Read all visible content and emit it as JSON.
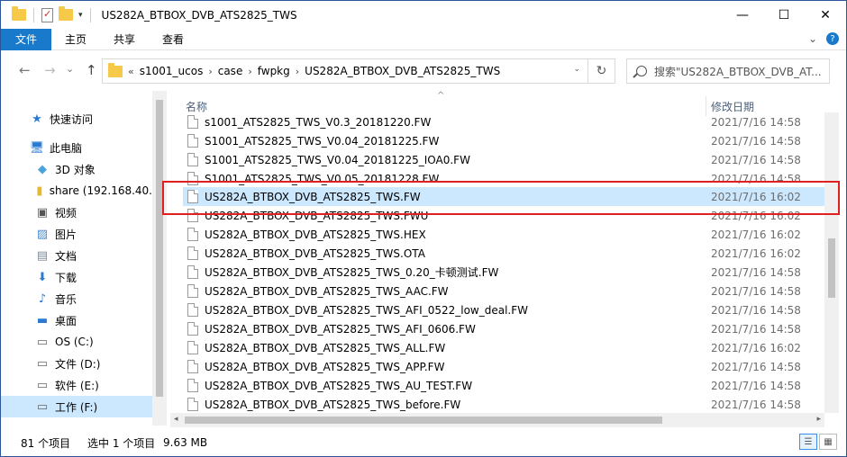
{
  "window": {
    "title": "US282A_BTBOX_DVB_ATS2825_TWS",
    "controls": {
      "minimize": "—",
      "maximize": "☐",
      "close": "✕"
    }
  },
  "ribbon": {
    "tabs": [
      "文件",
      "主页",
      "共享",
      "查看"
    ]
  },
  "nav": {
    "back": "←",
    "forward": "→",
    "recent": "⌄",
    "up": "↑",
    "overflow": "«",
    "breadcrumb": [
      "s1001_ucos",
      "case",
      "fwpkg",
      "US282A_BTBOX_DVB_ATS2825_TWS"
    ],
    "refresh": "↻",
    "search_placeholder": "搜索\"US282A_BTBOX_DVB_AT..."
  },
  "sidebar": {
    "items": [
      {
        "label": "快速访问",
        "icon": "star-icon"
      },
      {
        "label": "此电脑",
        "icon": "computer-icon"
      },
      {
        "label": "3D 对象",
        "icon": "cube-icon"
      },
      {
        "label": "share (192.168.40.",
        "icon": "network-drive-icon"
      },
      {
        "label": "视频",
        "icon": "video-icon"
      },
      {
        "label": "图片",
        "icon": "picture-icon"
      },
      {
        "label": "文档",
        "icon": "document-icon"
      },
      {
        "label": "下载",
        "icon": "download-icon"
      },
      {
        "label": "音乐",
        "icon": "music-icon"
      },
      {
        "label": "桌面",
        "icon": "desktop-icon"
      },
      {
        "label": "OS (C:)",
        "icon": "drive-icon"
      },
      {
        "label": "文件 (D:)",
        "icon": "drive-icon"
      },
      {
        "label": "软件 (E:)",
        "icon": "drive-icon"
      },
      {
        "label": "工作 (F:)",
        "icon": "drive-icon"
      }
    ],
    "selected_index": 13
  },
  "list": {
    "col_name": "名称",
    "col_date": "修改日期",
    "rows": [
      {
        "name": "s1001_ATS2825_TWS_V0.3_20181220.FW",
        "date": "2021/7/16 14:58"
      },
      {
        "name": "S1001_ATS2825_TWS_V0.04_20181225.FW",
        "date": "2021/7/16 14:58"
      },
      {
        "name": "S1001_ATS2825_TWS_V0.04_20181225_IOA0.FW",
        "date": "2021/7/16 14:58"
      },
      {
        "name": "S1001_ATS2825_TWS_V0.05_20181228.FW",
        "date": "2021/7/16 14:58"
      },
      {
        "name": "US282A_BTBOX_DVB_ATS2825_TWS.FW",
        "date": "2021/7/16 16:02"
      },
      {
        "name": "US282A_BTBOX_DVB_ATS2825_TWS.FWU",
        "date": "2021/7/16 16:02"
      },
      {
        "name": "US282A_BTBOX_DVB_ATS2825_TWS.HEX",
        "date": "2021/7/16 16:02"
      },
      {
        "name": "US282A_BTBOX_DVB_ATS2825_TWS.OTA",
        "date": "2021/7/16 16:02"
      },
      {
        "name": "US282A_BTBOX_DVB_ATS2825_TWS_0.20_卡顿测试.FW",
        "date": "2021/7/16 14:58"
      },
      {
        "name": "US282A_BTBOX_DVB_ATS2825_TWS_AAC.FW",
        "date": "2021/7/16 14:58"
      },
      {
        "name": "US282A_BTBOX_DVB_ATS2825_TWS_AFI_0522_low_deal.FW",
        "date": "2021/7/16 14:58"
      },
      {
        "name": "US282A_BTBOX_DVB_ATS2825_TWS_AFI_0606.FW",
        "date": "2021/7/16 14:58"
      },
      {
        "name": "US282A_BTBOX_DVB_ATS2825_TWS_ALL.FW",
        "date": "2021/7/16 16:02"
      },
      {
        "name": "US282A_BTBOX_DVB_ATS2825_TWS_APP.FW",
        "date": "2021/7/16 14:58"
      },
      {
        "name": "US282A_BTBOX_DVB_ATS2825_TWS_AU_TEST.FW",
        "date": "2021/7/16 14:58"
      },
      {
        "name": "US282A_BTBOX_DVB_ATS2825_TWS_before.FW",
        "date": "2021/7/16 14:58"
      }
    ],
    "selected_index": 4
  },
  "status": {
    "count": "81 个项目",
    "selected": "选中 1 个项目",
    "size": "9.63 MB"
  }
}
